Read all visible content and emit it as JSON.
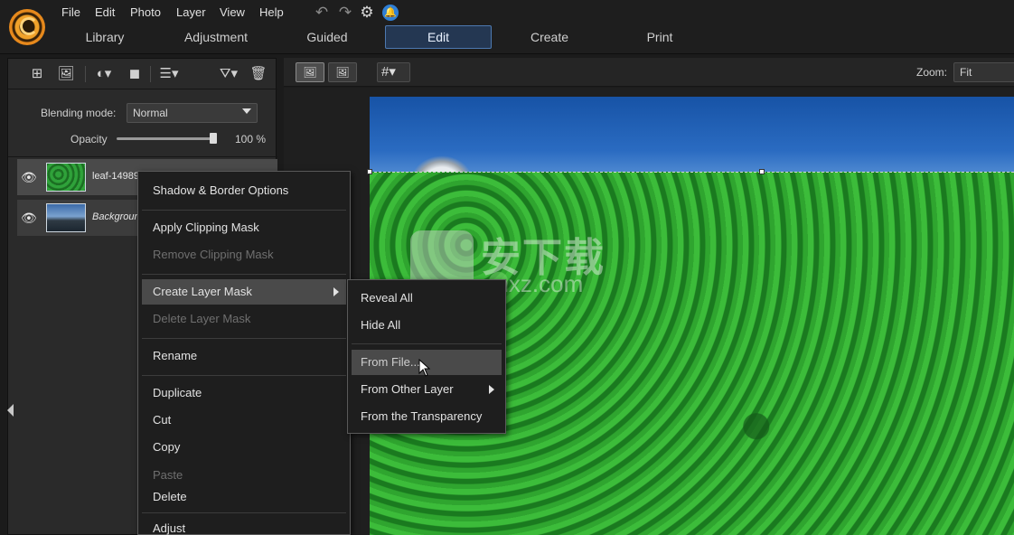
{
  "menubar": {
    "items": [
      "File",
      "Edit",
      "Photo",
      "Layer",
      "View",
      "Help"
    ]
  },
  "quick_icons": {
    "undo": "undo-icon",
    "redo": "redo-icon",
    "settings": "gear-icon",
    "notifications": "bell-icon"
  },
  "tabs": [
    {
      "label": "Library",
      "active": false
    },
    {
      "label": "Adjustment",
      "active": false
    },
    {
      "label": "Guided",
      "active": false
    },
    {
      "label": "Edit",
      "active": true
    },
    {
      "label": "Create",
      "active": false
    },
    {
      "label": "Print",
      "active": false
    }
  ],
  "layers_panel": {
    "blending_mode_label": "Blending mode:",
    "blending_mode_value": "Normal",
    "opacity_label": "Opacity",
    "opacity_value": "100 %",
    "opacity_fraction": 1.0,
    "layers": [
      {
        "name": "leaf-1498985_1920",
        "visible": true,
        "selected": true
      },
      {
        "name": "Background",
        "visible": true,
        "selected": false
      }
    ]
  },
  "canvas_toolbar": {
    "zoom_label": "Zoom:",
    "zoom_value": "Fit"
  },
  "watermark": {
    "text_main": "安下载",
    "text_sub": "anxz.com"
  },
  "context_menu": {
    "items": [
      {
        "label": "Shadow & Border Options",
        "enabled": true
      },
      {
        "label": "Apply Clipping Mask",
        "enabled": true
      },
      {
        "label": "Remove Clipping Mask",
        "enabled": false
      },
      {
        "label": "Create Layer Mask",
        "enabled": true,
        "submenu": true,
        "highlighted": true
      },
      {
        "label": "Delete Layer Mask",
        "enabled": false
      },
      {
        "label": "Rename",
        "enabled": true
      },
      {
        "label": "Duplicate",
        "enabled": true
      },
      {
        "label": "Cut",
        "enabled": true
      },
      {
        "label": "Copy",
        "enabled": true
      },
      {
        "label": "Paste",
        "enabled": false
      },
      {
        "label": "Delete",
        "enabled": true
      },
      {
        "label": "Adjust",
        "enabled": true
      }
    ]
  },
  "submenu": {
    "items": [
      {
        "label": "Reveal All",
        "enabled": true
      },
      {
        "label": "Hide All",
        "enabled": true
      },
      {
        "label": "From File...",
        "enabled": true,
        "highlighted": true
      },
      {
        "label": "From Other Layer",
        "enabled": true,
        "submenu": true
      },
      {
        "label": "From the Transparency",
        "enabled": true
      }
    ]
  },
  "colors": {
    "accent_tab": "#243752",
    "menu_bg": "#1e1e1e",
    "highlight": "#4a4a4a"
  }
}
